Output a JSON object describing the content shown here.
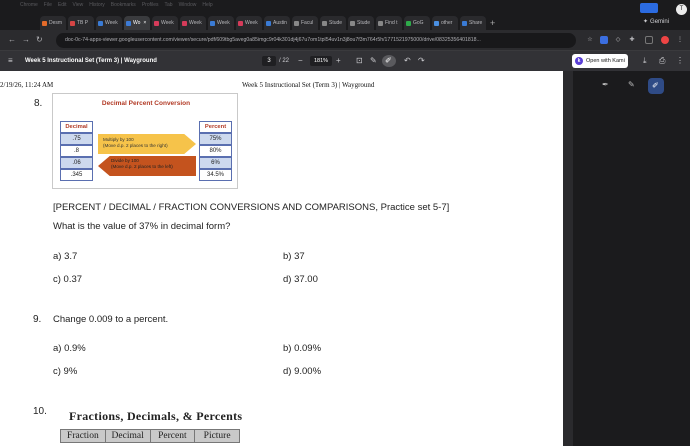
{
  "browser": {
    "menu": [
      "Chrome",
      "File",
      "Edit",
      "View",
      "History",
      "Bookmarks",
      "Profiles",
      "Tab",
      "Window",
      "Help"
    ],
    "tabs": [
      {
        "label": "Desm",
        "color": "#e36b2a",
        "active": false
      },
      {
        "label": "TB P",
        "color": "#d64545",
        "active": false
      },
      {
        "label": "Week",
        "color": "#3a7bd5",
        "active": false
      },
      {
        "label": "Wo",
        "color": "#3d7bd5",
        "active": true
      },
      {
        "label": "Week",
        "color": "#d63b5a",
        "active": false
      },
      {
        "label": "Week",
        "color": "#d63b5a",
        "active": false
      },
      {
        "label": "Week",
        "color": "#3a7bd5",
        "active": false
      },
      {
        "label": "Week",
        "color": "#d63b5a",
        "active": false
      },
      {
        "label": "Austin",
        "color": "#3a7bd5",
        "active": false
      },
      {
        "label": "Facul",
        "color": "#888888",
        "active": false
      },
      {
        "label": "Stude",
        "color": "#888888",
        "active": false
      },
      {
        "label": "Stude",
        "color": "#888888",
        "active": false
      },
      {
        "label": "Find t",
        "color": "#888888",
        "active": false
      },
      {
        "label": "GoG",
        "color": "#2eaa4a",
        "active": false
      },
      {
        "label": "other",
        "color": "#4a90e2",
        "active": false
      },
      {
        "label": "Share",
        "color": "#3a7bd5",
        "active": false
      }
    ],
    "new_tab": "+",
    "gemini_label": "Gemini",
    "profile_initial": "T",
    "url": "doc-0c-74-apps-viewer.googleusercontent.com/viewer/secure/pdf/609tbg5aveg0a85imgc9r04k301dj4j67u7om1tpl54uv1n3j8ou7f3m764r5h/1771521975000/drive/08325356401818..."
  },
  "pdf_toolbar": {
    "menu_icon": "≡",
    "title": "Week 5 Instructional Set (Term 3) | Wayground",
    "page_current": "3",
    "page_total": "/ 22",
    "zoom_out": "−",
    "zoom_level": "181%",
    "zoom_in": "+",
    "kami_label": "Open with Kami",
    "kami_logo": "k"
  },
  "document": {
    "header_left": "2/19/26, 11:24 AM",
    "header_center": "Week 5 Instructional Set (Term 3) | Wayground",
    "q8_number": "8.",
    "figure": {
      "title": "Decimal Percent Conversion",
      "left_header": "Decimal",
      "right_header": "Percent",
      "decimals": [
        ".75",
        ".8",
        ".06",
        ".345"
      ],
      "percents": [
        "75%",
        "80%",
        "6%",
        "34.5%"
      ],
      "arrow_right_line1": "Multiply by 100",
      "arrow_right_line2": "(Move d.p. 2 places to the right)",
      "arrow_left_line1": "Divide by 100",
      "arrow_left_line2": "(Move d.p. 2 places to the left)"
    },
    "section_heading": "[PERCENT / DECIMAL / FRACTION CONVERSIONS AND COMPARISONS, Practice set 5-7]",
    "q8_text": "What is the value of 37% in decimal form?",
    "q8_choices": [
      "a)  3.7",
      "b)  37",
      "c)  0.37",
      "d)  37.00"
    ],
    "q9_number": "9.",
    "q9_text": "Change 0.009 to a percent.",
    "q9_choices": [
      "a)  0.9%",
      "b)  0.09%",
      "c)  9%",
      "d)  9.00%"
    ],
    "q10_number": "10.",
    "q10_title": "Fractions, Decimals, & Percents",
    "q10_columns": [
      "Fraction",
      "Decimal",
      "Percent",
      "Picture"
    ]
  }
}
